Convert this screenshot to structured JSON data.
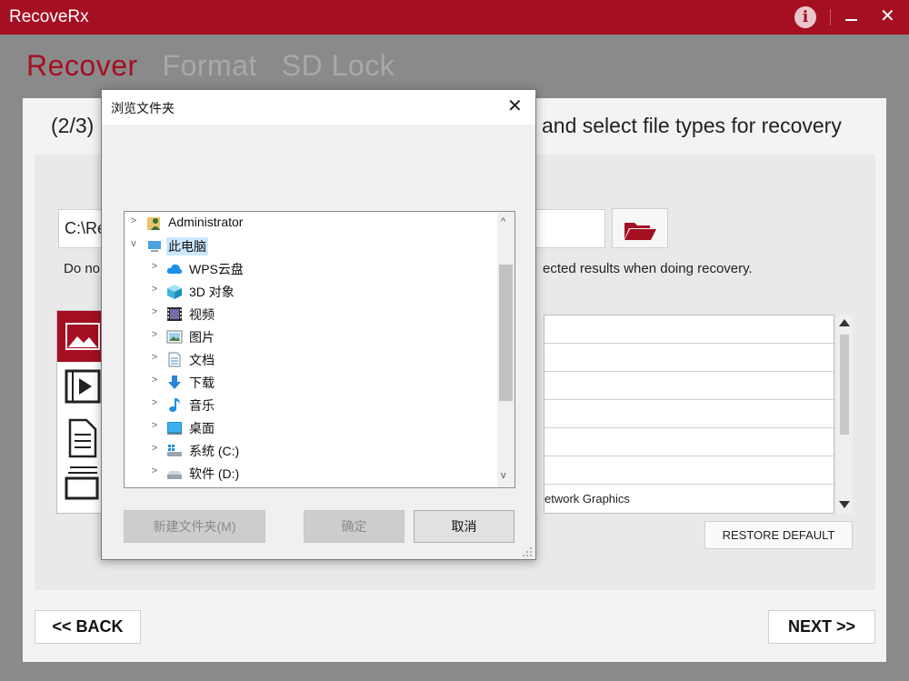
{
  "app": {
    "title": "RecoveRx",
    "info_icon_glyph": "i",
    "colors": {
      "brand": "#a50f22",
      "inactive_tab": "#a9a9a9"
    }
  },
  "tabs": [
    {
      "label": "Recover",
      "active": true
    },
    {
      "label": "Format",
      "active": false
    },
    {
      "label": "SD Lock",
      "active": false
    }
  ],
  "step": {
    "left_text": "(2/3)",
    "right_text": "and select file types for recovery"
  },
  "path": {
    "value": "C:\\Re"
  },
  "warning": {
    "left_text": "Do no",
    "right_text": "ected results when doing recovery."
  },
  "categories": [
    {
      "icon": "image-icon",
      "selected": true
    },
    {
      "icon": "video-icon",
      "selected": false
    },
    {
      "icon": "document-icon",
      "selected": false
    },
    {
      "icon": "other-files-icon",
      "selected": false
    }
  ],
  "filetypes": [
    "",
    "",
    "",
    "",
    "",
    "",
    "etwork Graphics"
  ],
  "buttons": {
    "restore": "RESTORE DEFAULT",
    "back_arrows": "<<",
    "back": "BACK",
    "next": "NEXT",
    "next_arrows": ">>"
  },
  "dialog": {
    "title": "浏览文件夹",
    "close_glyph": "✕",
    "tree": [
      {
        "label": "Administrator",
        "icon": "user-folder-icon",
        "level": 0,
        "expanded": false,
        "selected": false
      },
      {
        "label": "此电脑",
        "icon": "computer-icon",
        "level": 0,
        "expanded": true,
        "selected": true
      },
      {
        "label": "WPS云盘",
        "icon": "cloud-icon",
        "level": 1,
        "expanded": false,
        "selected": false
      },
      {
        "label": "3D 对象",
        "icon": "cube-icon",
        "level": 1,
        "expanded": false,
        "selected": false
      },
      {
        "label": "视频",
        "icon": "film-icon",
        "level": 1,
        "expanded": false,
        "selected": false
      },
      {
        "label": "图片",
        "icon": "picture-icon",
        "level": 1,
        "expanded": false,
        "selected": false
      },
      {
        "label": "文档",
        "icon": "document-icon",
        "level": 1,
        "expanded": false,
        "selected": false
      },
      {
        "label": "下载",
        "icon": "download-icon",
        "level": 1,
        "expanded": false,
        "selected": false
      },
      {
        "label": "音乐",
        "icon": "music-icon",
        "level": 1,
        "expanded": false,
        "selected": false
      },
      {
        "label": "桌面",
        "icon": "desktop-icon",
        "level": 1,
        "expanded": false,
        "selected": false
      },
      {
        "label": "系统 (C:)",
        "icon": "system-drive-icon",
        "level": 1,
        "expanded": false,
        "selected": false
      },
      {
        "label": "软件 (D:)",
        "icon": "drive-icon",
        "level": 1,
        "expanded": false,
        "selected": false
      }
    ],
    "new_folder": "新建文件夹(M)",
    "ok": "确定",
    "cancel": "取消"
  }
}
